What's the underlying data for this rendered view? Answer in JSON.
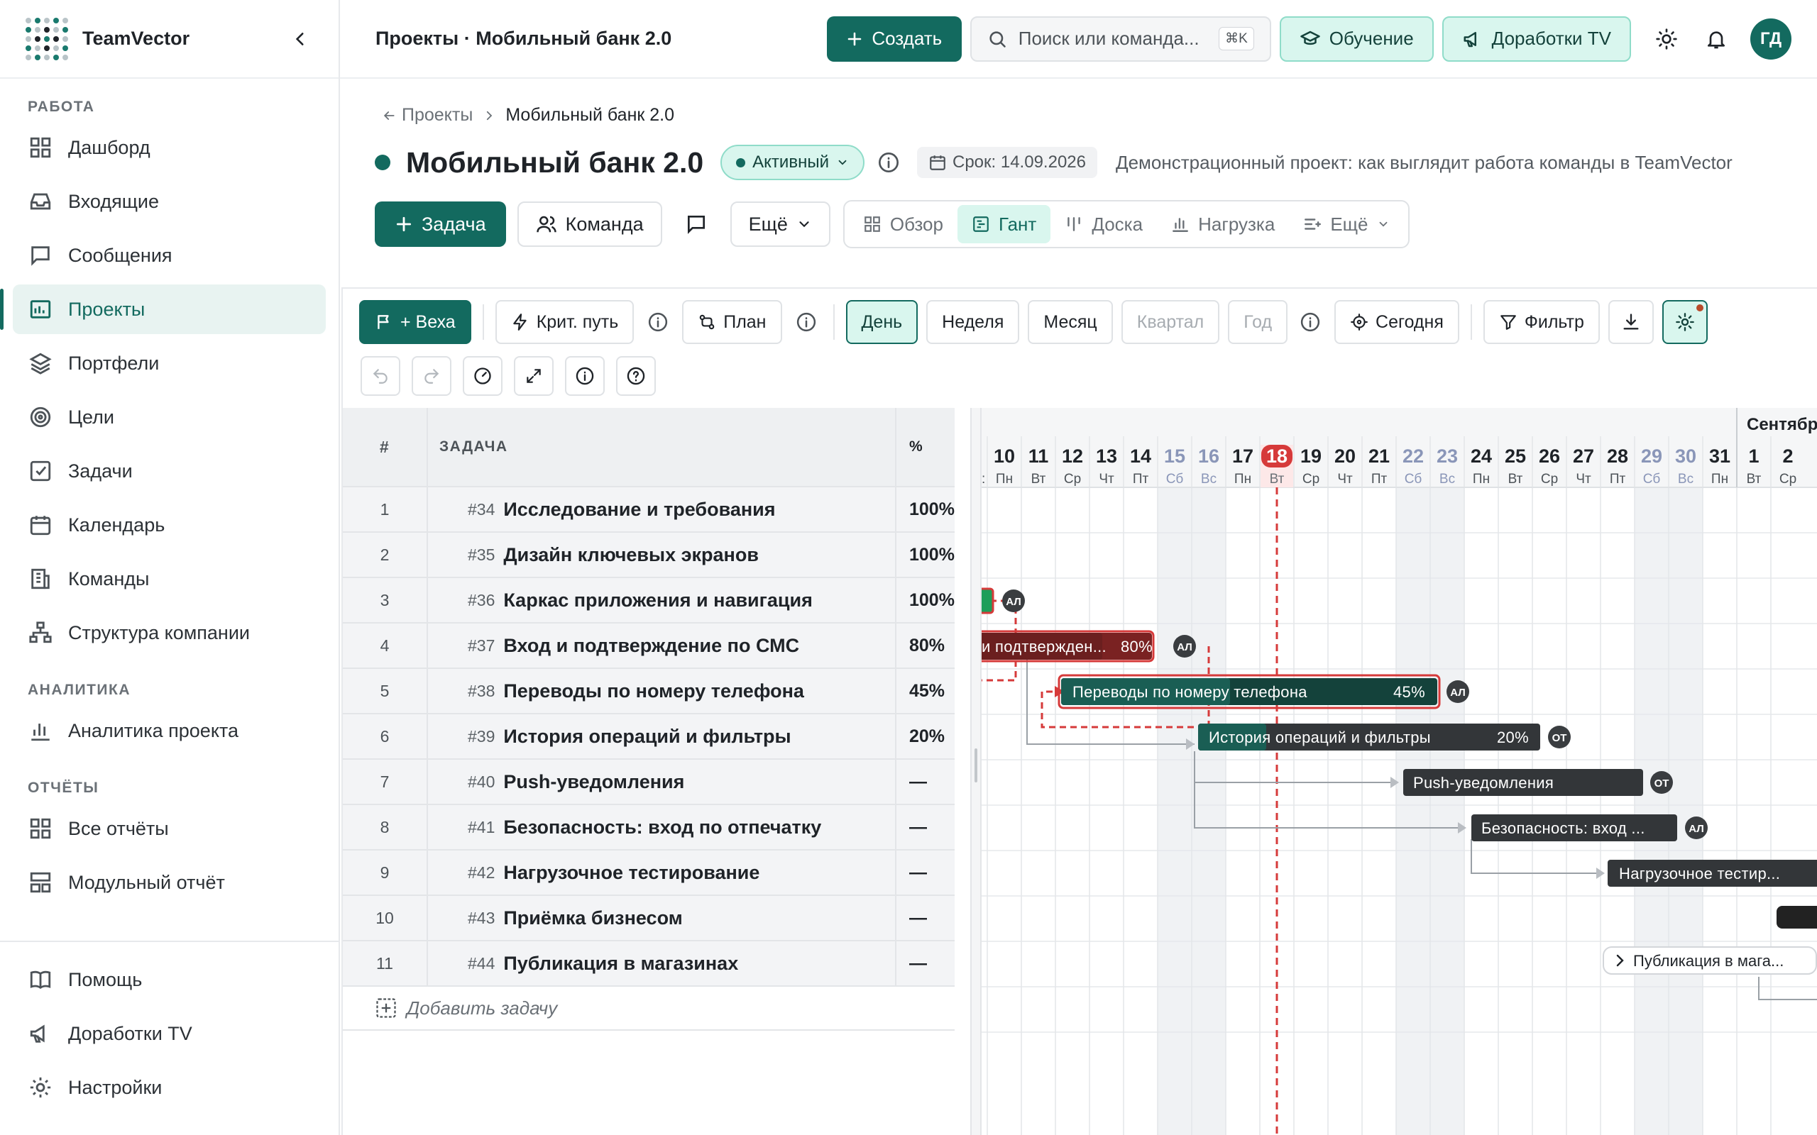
{
  "app": {
    "brand": "TeamVector"
  },
  "sidebar": {
    "sections": [
      {
        "title": "РАБОТА",
        "items": [
          {
            "label": "Дашборд",
            "icon": "grid-icon"
          },
          {
            "label": "Входящие",
            "icon": "inbox-icon"
          },
          {
            "label": "Сообщения",
            "icon": "message-icon"
          },
          {
            "label": "Проекты",
            "icon": "projects-icon",
            "active": true
          },
          {
            "label": "Портфели",
            "icon": "layers-icon"
          },
          {
            "label": "Цели",
            "icon": "target-icon"
          },
          {
            "label": "Задачи",
            "icon": "checkbox-icon"
          },
          {
            "label": "Календарь",
            "icon": "calendar-icon"
          },
          {
            "label": "Команды",
            "icon": "building-icon"
          },
          {
            "label": "Структура компании",
            "icon": "org-icon"
          }
        ]
      },
      {
        "title": "АНАЛИТИКА",
        "items": [
          {
            "label": "Аналитика проекта",
            "icon": "bar-chart-icon"
          }
        ]
      },
      {
        "title": "ОТЧЁТЫ",
        "items": [
          {
            "label": "Все отчёты",
            "icon": "grid-icon"
          },
          {
            "label": "Модульный отчёт",
            "icon": "layout-icon"
          }
        ]
      }
    ],
    "bottom": [
      {
        "label": "Помощь",
        "icon": "book-icon"
      },
      {
        "label": "Доработки TV",
        "icon": "megaphone-icon"
      },
      {
        "label": "Настройки",
        "icon": "gear-icon"
      }
    ]
  },
  "topbar": {
    "title": "Проекты · Мобильный банк 2.0",
    "create_label": "Создать",
    "search_placeholder": "Поиск или команда...",
    "search_shortcut": "⌘K",
    "learning_label": "Обучение",
    "feedback_label": "Доработки TV",
    "avatar_initials": "ГД"
  },
  "page": {
    "breadcrumb_back": "Проекты",
    "breadcrumb_current": "Мобильный банк 2.0",
    "title": "Мобильный банк 2.0",
    "status": "Активный",
    "deadline": "Срок: 14.09.2026",
    "description": "Демонстрационный проект: как выглядит работа команды в TeamVector",
    "actions": {
      "task": "Задача",
      "team": "Команда",
      "more": "Ещё"
    },
    "views": [
      {
        "label": "Обзор",
        "icon": "grid-icon"
      },
      {
        "label": "Гант",
        "icon": "gantt-icon",
        "active": true
      },
      {
        "label": "Доска",
        "icon": "board-icon"
      },
      {
        "label": "Нагрузка",
        "icon": "bar-chart-icon"
      },
      {
        "label": "Ещё",
        "icon": "more-icon"
      }
    ]
  },
  "gantt_toolbar": {
    "milestone": "+ Веха",
    "critical_path": "Крит. путь",
    "plan": "План",
    "scales": [
      "День",
      "Неделя",
      "Месяц",
      "Квартал",
      "Год"
    ],
    "active_scale": "День",
    "disabled_scales": [
      "Квартал",
      "Год"
    ],
    "today": "Сегодня",
    "filter": "Фильтр"
  },
  "table": {
    "col_num": "#",
    "col_task": "ЗАДАЧА",
    "col_pct": "%",
    "add_task": "Добавить задачу",
    "rows": [
      {
        "n": "1",
        "id": "#34",
        "name": "Исследование и требования",
        "pct": "100%"
      },
      {
        "n": "2",
        "id": "#35",
        "name": "Дизайн ключевых экранов",
        "pct": "100%"
      },
      {
        "n": "3",
        "id": "#36",
        "name": "Каркас приложения и навигация",
        "pct": "100%"
      },
      {
        "n": "4",
        "id": "#37",
        "name": "Вход и подтверждение по СМС",
        "pct": "80%"
      },
      {
        "n": "5",
        "id": "#38",
        "name": "Переводы по номеру телефона",
        "pct": "45%"
      },
      {
        "n": "6",
        "id": "#39",
        "name": "История операций и фильтры",
        "pct": "20%"
      },
      {
        "n": "7",
        "id": "#40",
        "name": "Push-уведомления",
        "pct": "—"
      },
      {
        "n": "8",
        "id": "#41",
        "name": "Безопасность: вход по отпечатку",
        "pct": "—"
      },
      {
        "n": "9",
        "id": "#42",
        "name": "Нагрузочное тестирование",
        "pct": "—"
      },
      {
        "n": "10",
        "id": "#43",
        "name": "Приёмка бизнесом",
        "pct": "—"
      },
      {
        "n": "11",
        "id": "#44",
        "name": "Публикация в магазинах",
        "pct": "—"
      }
    ]
  },
  "timeline": {
    "month_label": "Сентябрь",
    "today_day": 18,
    "days": [
      {
        "d": "10",
        "w": "Пн"
      },
      {
        "d": "11",
        "w": "Вт"
      },
      {
        "d": "12",
        "w": "Ср"
      },
      {
        "d": "13",
        "w": "Чт"
      },
      {
        "d": "14",
        "w": "Пт"
      },
      {
        "d": "15",
        "w": "Сб",
        "we": true
      },
      {
        "d": "16",
        "w": "Вс",
        "we": true
      },
      {
        "d": "17",
        "w": "Пн"
      },
      {
        "d": "18",
        "w": "Вт",
        "today": true
      },
      {
        "d": "19",
        "w": "Ср"
      },
      {
        "d": "20",
        "w": "Чт"
      },
      {
        "d": "21",
        "w": "Пт"
      },
      {
        "d": "22",
        "w": "Сб",
        "we": true
      },
      {
        "d": "23",
        "w": "Вс",
        "we": true
      },
      {
        "d": "24",
        "w": "Пн"
      },
      {
        "d": "25",
        "w": "Вт"
      },
      {
        "d": "26",
        "w": "Ср"
      },
      {
        "d": "27",
        "w": "Чт"
      },
      {
        "d": "28",
        "w": "Пт"
      },
      {
        "d": "29",
        "w": "Сб",
        "we": true
      },
      {
        "d": "30",
        "w": "Вс",
        "we": true
      },
      {
        "d": "31",
        "w": "Пн"
      },
      {
        "d": "1",
        "w": "Вт"
      },
      {
        "d": "2",
        "w": "Ср"
      }
    ],
    "bars": [
      {
        "row": 3,
        "label": "",
        "pct_text": "",
        "assignee": "АЛ",
        "status": "done",
        "critical": true
      },
      {
        "row": 4,
        "label": "Вход и подтверждение по СМС",
        "pct_text": "80%",
        "assignee": "АЛ",
        "status": "critical",
        "critical": true
      },
      {
        "row": 5,
        "label": "Переводы по номеру телефона",
        "pct_text": "45%",
        "assignee": "АЛ",
        "status": "active",
        "critical": true
      },
      {
        "row": 6,
        "label": "История операций и фильтры",
        "pct_text": "20%",
        "assignee": "ОТ",
        "status": "active"
      },
      {
        "row": 7,
        "label": "Push-уведомления",
        "pct_text": "",
        "assignee": "ОТ",
        "status": "planned"
      },
      {
        "row": 8,
        "label": "Безопасность: вход по отпечатку",
        "pct_text": "",
        "assignee": "АЛ",
        "status": "planned"
      },
      {
        "row": 9,
        "label": "Нагрузочное тестирование",
        "pct_text": "",
        "assignee": "",
        "status": "planned"
      },
      {
        "row": 11,
        "label": "Публикация в магазинах",
        "pct_text": "",
        "assignee": "",
        "status": "milestone-group"
      }
    ],
    "colors": {
      "accent": "#136a5f",
      "critical": "#d63a3a",
      "done": "#1e9e5a",
      "planned": "#333639",
      "today": "#d63a3a"
    }
  }
}
